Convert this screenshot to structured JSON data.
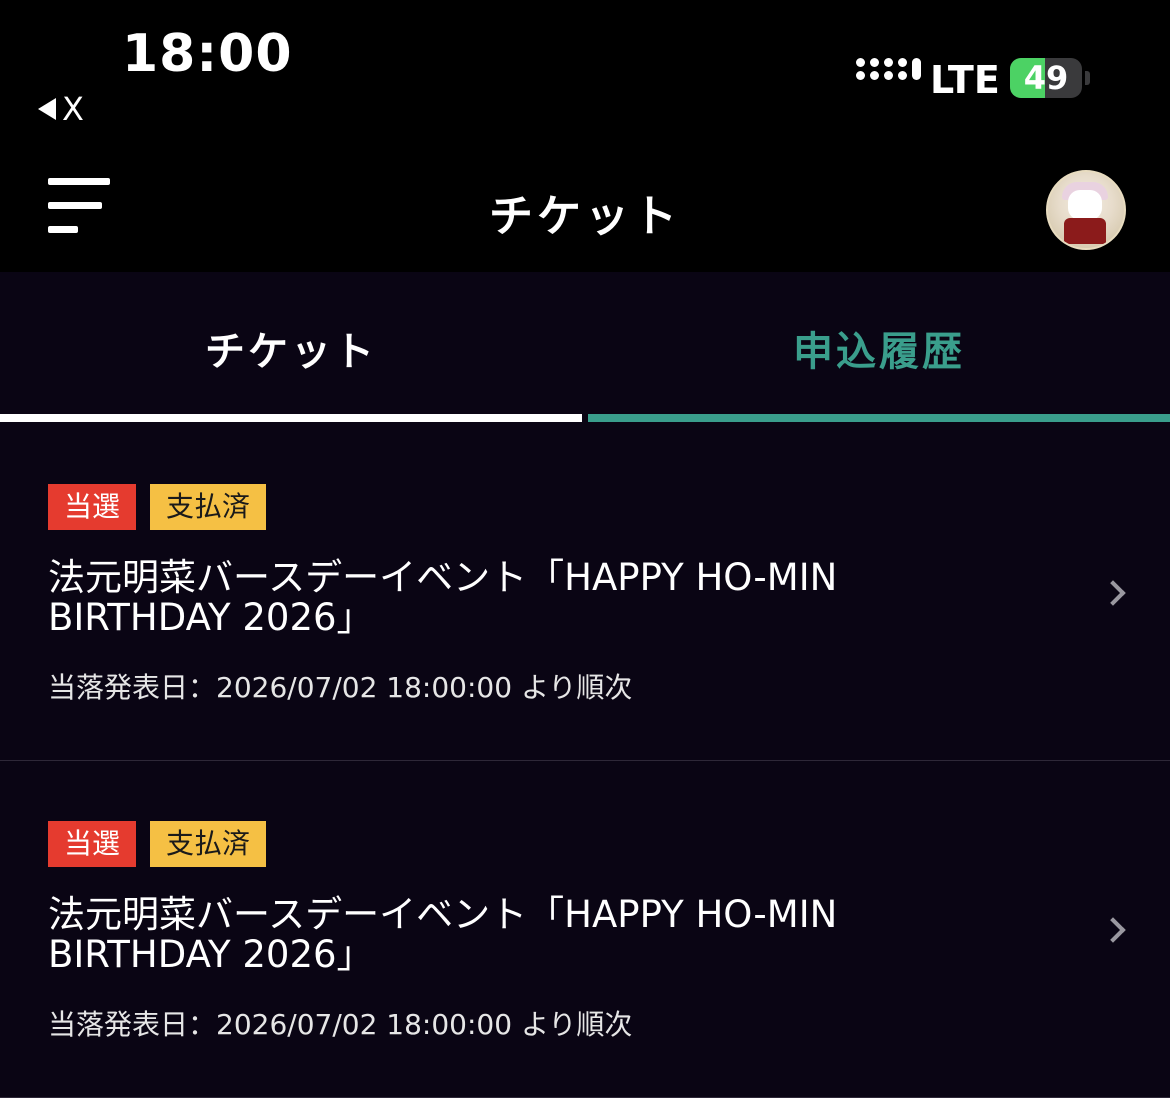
{
  "status_bar": {
    "time": "18:00",
    "back_app": "X",
    "network": "LTE",
    "battery": "49",
    "battery_level": 0.49
  },
  "app_bar": {
    "title": "チケット"
  },
  "tabs": [
    {
      "label": "チケット",
      "selected": true
    },
    {
      "label": "申込履歴",
      "selected": false
    }
  ],
  "tickets": [
    {
      "badges": [
        "当選",
        "支払済"
      ],
      "title": "法元明菜バースデーイベント「HAPPY HO-MIN BIRTHDAY 2026」",
      "date": "当落発表日：2026/07/02 18:00:00 より順次"
    },
    {
      "badges": [
        "当選",
        "支払済"
      ],
      "title": "法元明菜バースデーイベント「HAPPY HO-MIN BIRTHDAY 2026」",
      "date": "当落発表日：2026/07/02 18:00:00 より順次"
    }
  ],
  "colors": {
    "background": "#0a0514",
    "accent": "#3a9e8c",
    "badge_win": "#e53b2f",
    "badge_paid": "#f5c044"
  }
}
